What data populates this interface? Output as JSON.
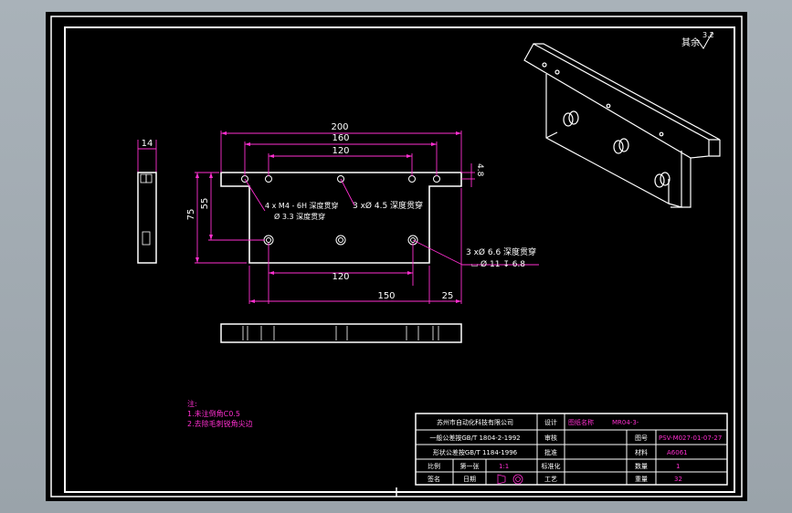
{
  "drawing": {
    "roughness": {
      "label": "其余",
      "value": "3.2"
    },
    "dimensions": {
      "top_overall": "200",
      "top_160": "160",
      "top_120": "120",
      "right_48": "4.8",
      "left_14": "14",
      "left_75": "75",
      "left_55": "55",
      "bottom_120": "120",
      "bottom_150": "150",
      "bottom_25": "25"
    },
    "callouts": {
      "holes_4x": "4 x  M4 - 6H 深度贯穿",
      "holes_4x_sub": "Ø  3.3 深度贯穿",
      "holes_3x_top": "3 xØ  4.5 深度贯穿",
      "holes_3x_right": "3 xØ  6.6 深度贯穿",
      "holes_3x_right_sub": "⌴ Ø 11  ↧ 6.8"
    },
    "notes": {
      "title": "注:",
      "line1": "1.未注倒角C0.5",
      "line2": "2.去除毛刺锐角尖边"
    }
  },
  "title_block": {
    "company": "苏州市自动化科技有限公司",
    "row2_left": "一般公差按GB/T 1804-2-1992",
    "row3_left": "形状公差按GB/T 1184-1996",
    "scale_label": "比例",
    "scale_value": "1:1",
    "sheet_label": "第一张",
    "sign_label": "签名",
    "date_label": "日期",
    "designer_label": "设计",
    "design_name": "图纸名称",
    "part_name": "MR04-3-",
    "drawing_no_label": "图号",
    "drawing_no": "PSV-M027-01-07-27",
    "material_label": "材料",
    "material_value": "A6061",
    "qty_label": "数量",
    "qty_value": "1",
    "weight_label": "重量",
    "weight_value": "32",
    "review_label": "审核",
    "approve_label": "批准",
    "process_label": "工艺",
    "standard_label": "标准化"
  },
  "colors": {
    "background": "#000000",
    "line_white": "#ffffff",
    "dimension_magenta": "#ff2fd0",
    "desktop_gray": "#a4adb4"
  }
}
